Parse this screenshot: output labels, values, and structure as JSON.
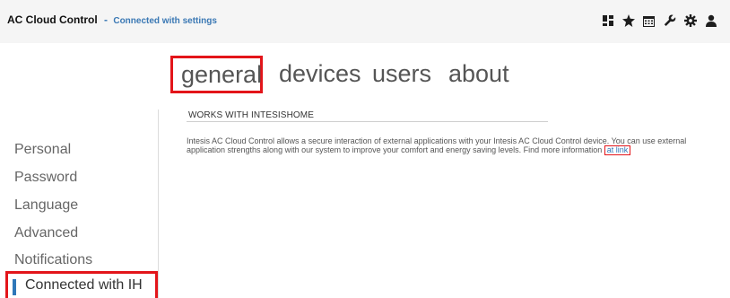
{
  "header": {
    "app_title": "AC Cloud Control",
    "separator": "-",
    "subtitle": "Connected with settings",
    "icons": [
      "dashboard-icon",
      "star-icon",
      "calendar-icon",
      "wrench-icon",
      "gear-icon",
      "user-icon"
    ]
  },
  "tabs": [
    {
      "label": "general",
      "selected": true
    },
    {
      "label": "devices",
      "selected": false
    },
    {
      "label": "users",
      "selected": false
    },
    {
      "label": "about",
      "selected": false
    }
  ],
  "sidebar": {
    "items": [
      {
        "label": "Personal"
      },
      {
        "label": "Password"
      },
      {
        "label": "Language"
      },
      {
        "label": "Advanced"
      },
      {
        "label": "Notifications"
      },
      {
        "label": "Connected with IH",
        "active": true
      }
    ]
  },
  "content": {
    "section_title": "WORKS WITH INTESISHOME",
    "description": "Intesis AC Cloud Control allows a secure interaction of external applications with your Intesis AC Cloud Control device. You can use external application strengths along with our system to improve your comfort and energy saving levels. Find more information",
    "link_text": "at link"
  },
  "colors": {
    "accent_blue": "#2e77b9",
    "highlight_red": "#e3151a",
    "topbar_bg": "#f5f5f5"
  }
}
